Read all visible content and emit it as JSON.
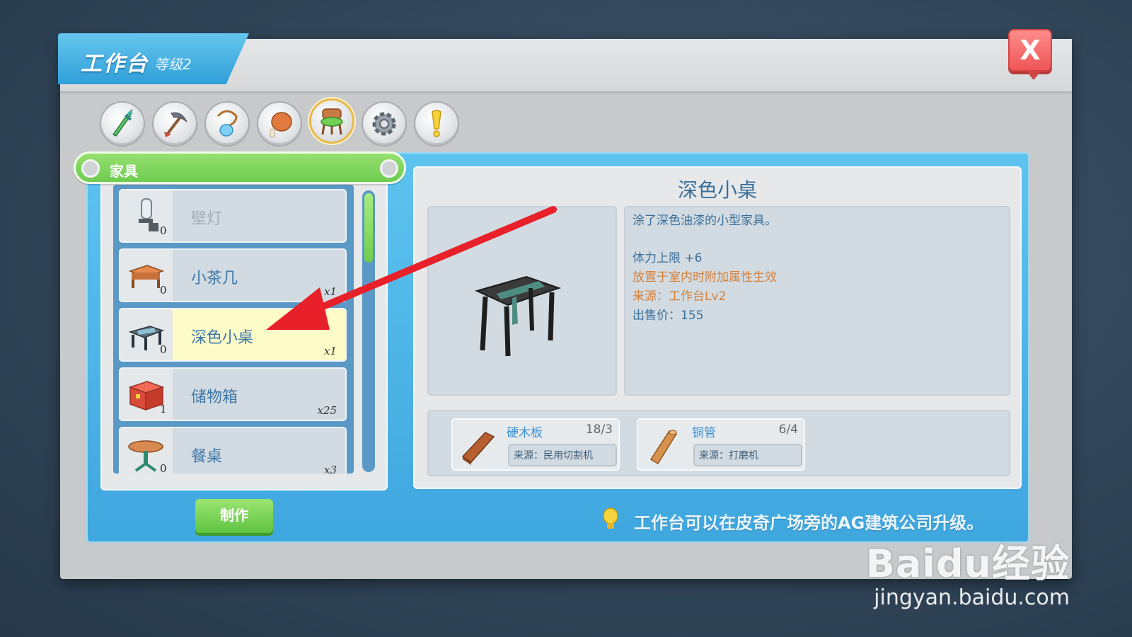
{
  "window": {
    "title": "工作台",
    "level": "等级2",
    "close_label": "X"
  },
  "category_tabs": [
    {
      "icon": "sword-icon",
      "active": false
    },
    {
      "icon": "pickaxe-icon",
      "active": false
    },
    {
      "icon": "pendant-icon",
      "active": false
    },
    {
      "icon": "meat-icon",
      "active": false
    },
    {
      "icon": "chair-icon",
      "active": true
    },
    {
      "icon": "gear-icon",
      "active": false
    },
    {
      "icon": "exclamation-icon",
      "active": false
    }
  ],
  "list": {
    "category_label": "家具",
    "items": [
      {
        "name": "壁灯",
        "owned": "0",
        "qty": "",
        "icon": "wall-lamp-icon",
        "disabled": true
      },
      {
        "name": "小茶几",
        "owned": "0",
        "qty": "x1",
        "icon": "tea-table-icon",
        "disabled": false
      },
      {
        "name": "深色小桌",
        "owned": "0",
        "qty": "x1",
        "icon": "dark-table-icon",
        "selected": true
      },
      {
        "name": "储物箱",
        "owned": "1",
        "qty": "x25",
        "icon": "storage-box-icon",
        "disabled": false
      },
      {
        "name": "餐桌",
        "owned": "0",
        "qty": "x3",
        "icon": "dining-table-icon",
        "disabled": false
      }
    ]
  },
  "make_button": "制作",
  "detail": {
    "title": "深色小桌",
    "description": "涂了深色油漆的小型家具。",
    "stat": "体力上限 +6",
    "effect_note": "放置于室内时附加属性生效",
    "source": "来源：工作台Lv2",
    "price": "出售价：155",
    "materials": [
      {
        "name": "硬木板",
        "count": "18/3",
        "source": "来源：民用切割机",
        "icon": "wood-plank-icon"
      },
      {
        "name": "铜管",
        "count": "6/4",
        "source": "来源：打磨机",
        "icon": "copper-pipe-icon"
      }
    ]
  },
  "tip": "工作台可以在皮奇广场旁的AG建筑公司升级。",
  "watermark": {
    "brand": "Baidu经验",
    "url": "jingyan.baidu.com"
  },
  "colors": {
    "accent_blue": "#3fa7df",
    "accent_green": "#6ecc4f",
    "close_red": "#ee5656",
    "arrow_red": "#e8202a"
  }
}
